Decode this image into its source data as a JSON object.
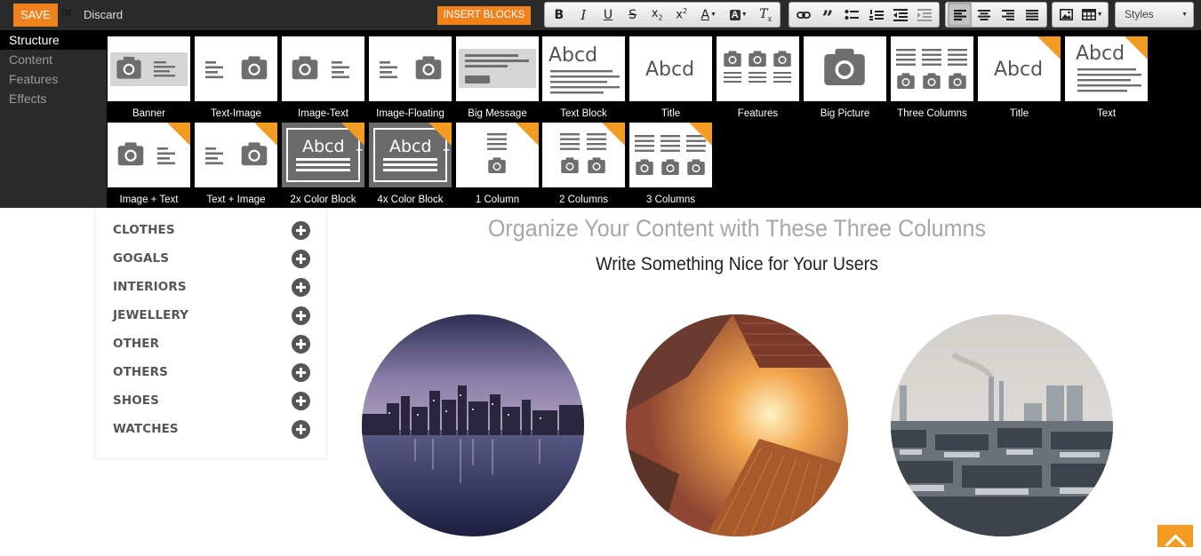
{
  "toolbar": {
    "save_label": "SAVE",
    "or_text": "or",
    "discard_label": "Discard",
    "insert_label": "INSERT BLOCKS",
    "styles_label": "Styles",
    "format_buttons": [
      "bold",
      "italic",
      "underline",
      "strikethrough",
      "subscript",
      "superscript",
      "text-color",
      "background-color",
      "remove-format"
    ],
    "insert_buttons": [
      "link",
      "blockquote",
      "bulleted-list",
      "numbered-list",
      "decrease-indent",
      "increase-indent"
    ],
    "align_buttons": [
      "align-left",
      "align-center",
      "align-right",
      "justify"
    ],
    "active_alignment": "align-left",
    "media_buttons": [
      "image",
      "table"
    ]
  },
  "panel": {
    "categories": [
      "Structure",
      "Content",
      "Features",
      "Effects"
    ],
    "active_category": "Structure",
    "blocks": [
      {
        "label": "Banner",
        "icon": "banner-icon",
        "new": false
      },
      {
        "label": "Text-Image",
        "icon": "text-image-icon",
        "new": false
      },
      {
        "label": "Image-Text",
        "icon": "image-text-icon",
        "new": false
      },
      {
        "label": "Image-Floating",
        "icon": "image-floating-icon",
        "new": false
      },
      {
        "label": "Big Message",
        "icon": "big-message-icon",
        "new": false
      },
      {
        "label": "Text Block",
        "icon": "text-block-icon",
        "new": false
      },
      {
        "label": "Title",
        "icon": "title-icon",
        "new": false
      },
      {
        "label": "Features",
        "icon": "features-icon",
        "new": false
      },
      {
        "label": "Big Picture",
        "icon": "big-picture-icon",
        "new": false
      },
      {
        "label": "Three Columns",
        "icon": "three-columns-icon",
        "new": false
      },
      {
        "label": "Title",
        "icon": "title-icon",
        "new": true
      },
      {
        "label": "Text",
        "icon": "text-icon",
        "new": true
      },
      {
        "label": "Image + Text",
        "icon": "image-text-icon",
        "new": true
      },
      {
        "label": "Text + Image",
        "icon": "text-image-icon",
        "new": true
      },
      {
        "label": "2x Color Block",
        "icon": "color-block-icon",
        "new": true
      },
      {
        "label": "4x Color Block",
        "icon": "color-block-icon",
        "new": true
      },
      {
        "label": "1 Column",
        "icon": "one-column-icon",
        "new": true
      },
      {
        "label": "2 Columns",
        "icon": "two-columns-icon",
        "new": true
      },
      {
        "label": "3 Columns",
        "icon": "three-columns-icon",
        "new": true
      }
    ],
    "thumb_text": "Abcd",
    "new_badge": "+"
  },
  "sidebar": {
    "items": [
      "CLOTHES",
      "GOGALS",
      "INTERIORS",
      "JEWELLERY",
      "OTHER",
      "OTHERS",
      "SHOES",
      "WATCHES"
    ]
  },
  "content": {
    "title": "Organize Your Content with These Three Columns",
    "subtitle": "Write Something Nice for Your Users",
    "images": [
      "city-night-skyline-image",
      "skyscraper-sky-image",
      "city-rooftops-image"
    ]
  },
  "colors": {
    "accent": "#f0821e",
    "toolbar_bg": "#2b2b2b",
    "panel_bg": "#000000",
    "icon_gray": "#6e6e6e",
    "title_gray": "#a7a7a7"
  }
}
